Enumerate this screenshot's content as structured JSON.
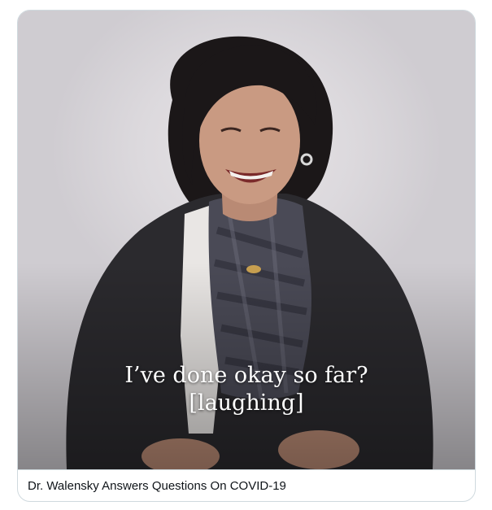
{
  "media": {
    "subtitle_line1": "I’ve done okay so far?",
    "subtitle_line2": "[laughing]"
  },
  "card": {
    "title": "Dr. Walensky Answers Questions On COVID-19"
  }
}
